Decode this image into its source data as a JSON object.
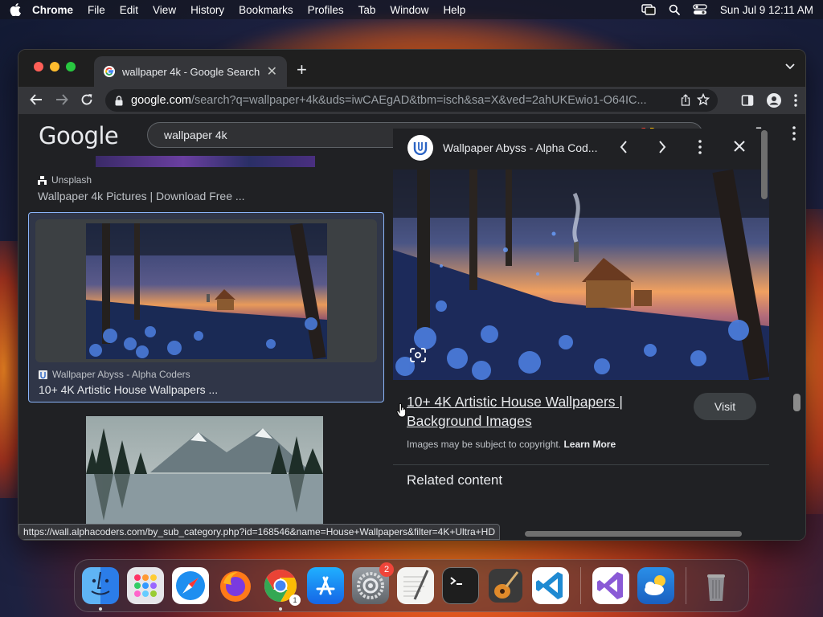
{
  "menubar": {
    "app_name": "Chrome",
    "items": [
      "File",
      "Edit",
      "View",
      "History",
      "Bookmarks",
      "Profiles",
      "Tab",
      "Window",
      "Help"
    ],
    "clock": "Sun Jul 9  12:11 AM"
  },
  "browser": {
    "tab_title": "wallpaper 4k - Google Search",
    "new_tab_symbol": "+",
    "url_host": "google.com",
    "url_path": "/search?q=wallpaper+4k&uds=iwCAEgAD&tbm=isch&sa=X&ved=2ahUKEwio1-O64IC...",
    "status_url": "https://wall.alphacoders.com/by_sub_category.php?id=168546&name=House+Wallpapers&filter=4K+Ultra+HD"
  },
  "google": {
    "logo": "Google",
    "query": "wallpaper 4k",
    "results": [
      {
        "source": "Unsplash",
        "title": "Wallpaper 4k Pictures | Download Free ..."
      },
      {
        "source": "Wallpaper Abyss - Alpha Coders",
        "title": "10+ 4K Artistic House Wallpapers ..."
      }
    ],
    "preview": {
      "site": "Wallpaper Abyss - Alpha Cod...",
      "title": "10+ 4K Artistic House Wallpapers | Background Images",
      "visit_label": "Visit",
      "copyright_text": "Images may be subject to copyright.",
      "learn_more": "Learn More",
      "related_heading": "Related content"
    }
  },
  "dock": {
    "apps": [
      "Finder",
      "Launchpad",
      "Safari",
      "Firefox",
      "Chrome",
      "App Store",
      "System Settings",
      "TextEdit",
      "Terminal",
      "GarageBand",
      "VS Code",
      "Visual Studio",
      "Weather",
      "Trash"
    ],
    "settings_badge": "2",
    "chrome_badge": "1"
  },
  "colors": {
    "page_bg": "#202124",
    "accent_blue": "#8ab4f8",
    "selected_card": "#303648"
  }
}
